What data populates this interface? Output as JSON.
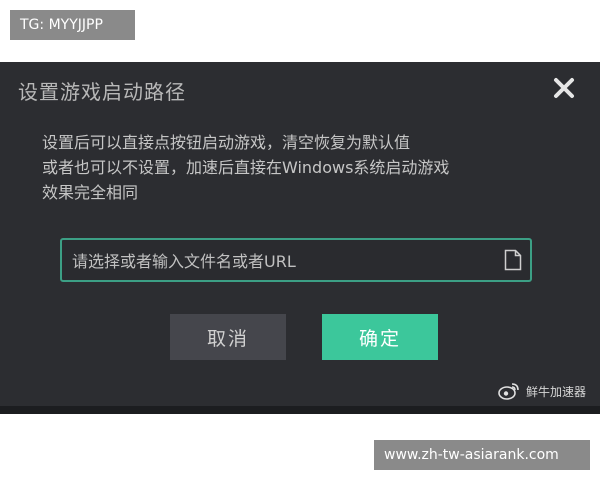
{
  "top_tag": "TG: MYYJJPP",
  "dialog": {
    "title": "设置游戏启动路径",
    "description_lines": [
      "设置后可以直接点按钮启动游戏，清空恢复为默认值",
      "或者也可以不设置，加速后直接在Windows系统启动游戏",
      "效果完全相同"
    ],
    "path_input": {
      "value": "",
      "placeholder": "请选择或者输入文件名或者URL"
    },
    "cancel_label": "取消",
    "confirm_label": "确定",
    "watermark_text": "鲜牛加速器"
  },
  "bottom_tag": "www.zh-tw-asiarank.com",
  "colors": {
    "dialog_bg": "#2c2d31",
    "input_border": "#3c9f85",
    "confirm_bg": "#3cc79b",
    "cancel_bg": "#45464c",
    "tag_bg": "#8a8a8a"
  },
  "icons": {
    "close": "close-icon",
    "file": "file-icon",
    "weibo": "weibo-icon"
  }
}
